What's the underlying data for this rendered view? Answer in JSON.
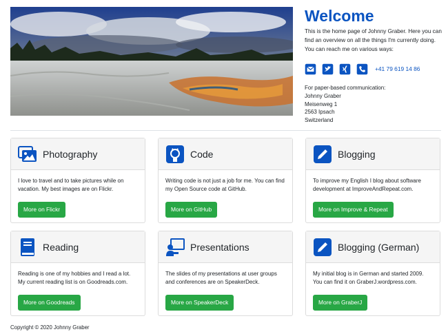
{
  "intro": {
    "title": "Welcome",
    "description": "This is the home page of Johnny Graber. Here you can find an overview on all the things I'm currently doing. You can reach me on various ways:",
    "phone": "+41 79 619 14 86",
    "contact_icons": [
      "envelope-icon",
      "twitter-icon",
      "xing-icon",
      "phone-icon"
    ],
    "address_label": "For paper-based communication:",
    "address_lines": [
      "Johnny Graber",
      "Meisenweg 1",
      "2563 Ipsach",
      "Switzerland"
    ]
  },
  "cards": [
    {
      "icon": "images-icon",
      "title": "Photography",
      "text": "I love to travel and to take pictures while on vacation. My best images are on Flickr.",
      "button": "More on Flickr"
    },
    {
      "icon": "github-icon",
      "title": "Code",
      "text": "Writing code is not just a job for me. You can find my Open Source code at GitHub.",
      "button": "More on GitHub"
    },
    {
      "icon": "pen-square-icon",
      "title": "Blogging",
      "text": "To improve my English I blog about software development at ImproveAndRepeat.com.",
      "button": "More on Improve & Repeat"
    },
    {
      "icon": "book-icon",
      "title": "Reading",
      "text": "Reading is one of my hobbies and I read a lot. My current reading list is on Goodreads.com.",
      "button": "More on Goodreads"
    },
    {
      "icon": "presenter-icon",
      "title": "Presentations",
      "text": "The slides of my presentations at user groups and conferences are on SpeakerDeck.",
      "button": "More on SpeakerDeck"
    },
    {
      "icon": "pen-square-icon",
      "title": "Blogging (German)",
      "text": "My initial blog is in German and started 2009. You can find it on GraberJ.wordpress.com.",
      "button": "More on GraberJ"
    }
  ],
  "footer": {
    "copyright": "Copyright © 2020 Johnny Graber"
  },
  "colors": {
    "accent": "#0b54c1",
    "button": "#28a745",
    "card_header": "#f5f5f5"
  }
}
